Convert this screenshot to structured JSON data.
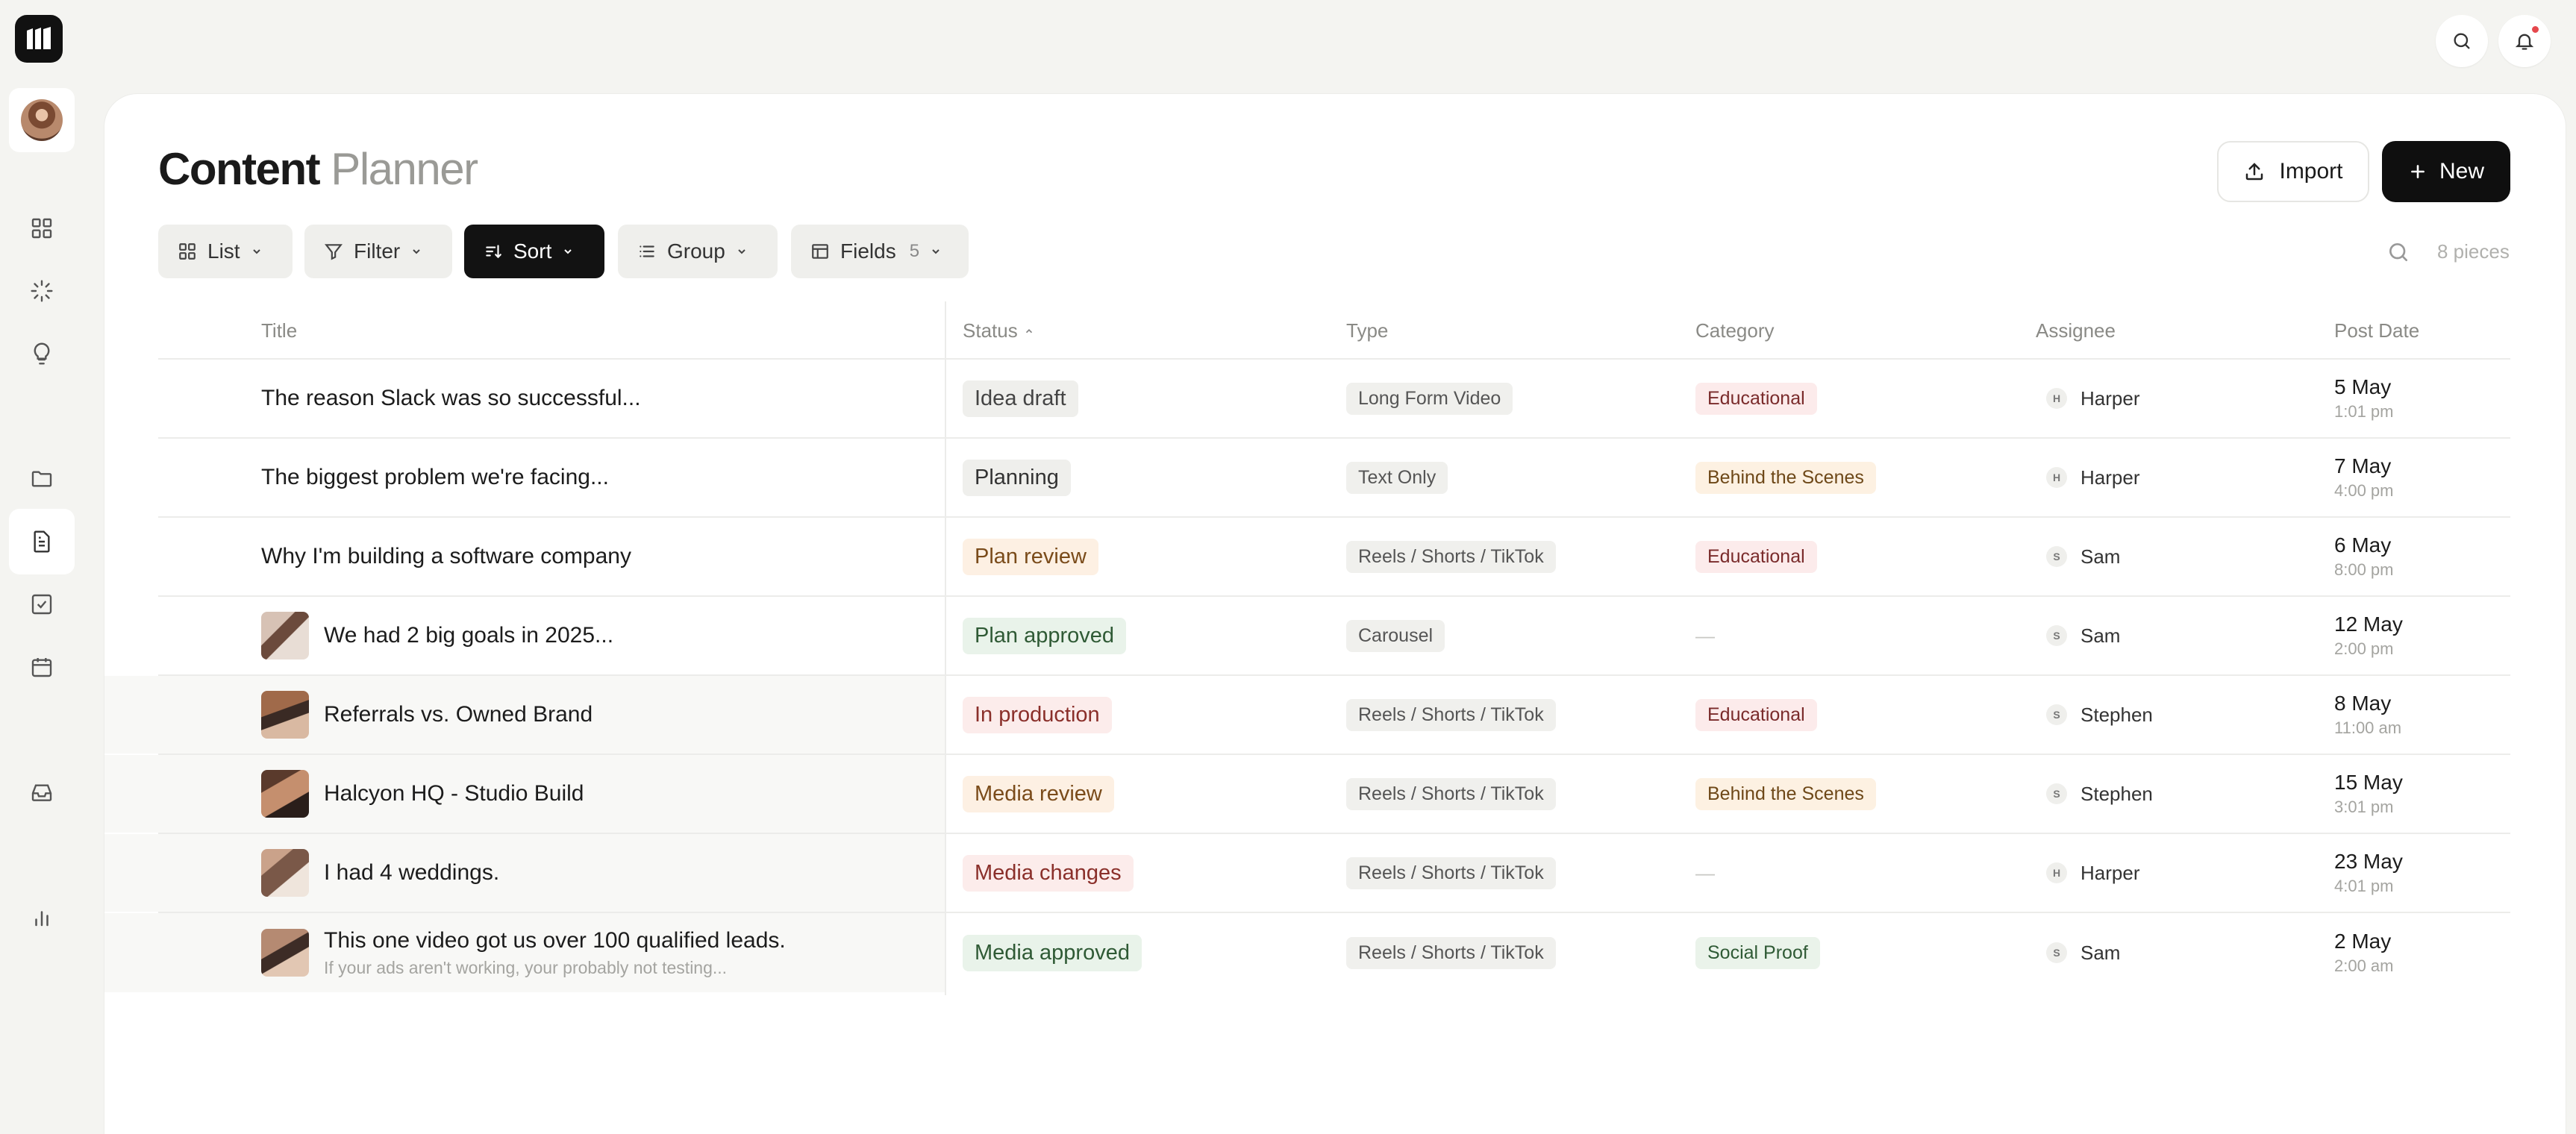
{
  "header": {
    "title_bold": "Content",
    "title_light": "Planner",
    "import_label": "Import",
    "new_label": "New"
  },
  "toolbar": {
    "list_label": "List",
    "filter_label": "Filter",
    "sort_label": "Sort",
    "group_label": "Group",
    "fields_label": "Fields",
    "fields_count": "5",
    "pieces_label": "8 pieces"
  },
  "columns": {
    "title": "Title",
    "status": "Status",
    "type": "Type",
    "category": "Category",
    "assignee": "Assignee",
    "post_date": "Post Date"
  },
  "rows": [
    {
      "title": "The reason Slack was so successful...",
      "subtitle": "",
      "status": "Idea draft",
      "type": "Long Form Video",
      "category": "Educational",
      "assignee": "Harper",
      "initial": "H",
      "date": "5 May",
      "time": "1:01 pm"
    },
    {
      "title": "The biggest problem we're facing...",
      "subtitle": "",
      "status": "Planning",
      "type": "Text Only",
      "category": "Behind the Scenes",
      "assignee": "Harper",
      "initial": "H",
      "date": "7 May",
      "time": "4:00 pm"
    },
    {
      "title": "Why I'm building a software company",
      "subtitle": "",
      "status": "Plan review",
      "type": "Reels / Shorts / TikTok",
      "category": "Educational",
      "assignee": "Sam",
      "initial": "S",
      "date": "6 May",
      "time": "8:00 pm"
    },
    {
      "title": "We had 2 big goals in 2025...",
      "subtitle": "",
      "status": "Plan approved",
      "type": "Carousel",
      "category": "—",
      "assignee": "Sam",
      "initial": "S",
      "date": "12 May",
      "time": "2:00 pm"
    },
    {
      "title": "Referrals vs. Owned Brand",
      "subtitle": "",
      "status": "In production",
      "type": "Reels / Shorts / TikTok",
      "category": "Educational",
      "assignee": "Stephen",
      "initial": "S",
      "date": "8 May",
      "time": "11:00 am"
    },
    {
      "title": "Halcyon HQ - Studio Build",
      "subtitle": "",
      "status": "Media review",
      "type": "Reels / Shorts / TikTok",
      "category": "Behind the Scenes",
      "assignee": "Stephen",
      "initial": "S",
      "date": "15 May",
      "time": "3:01 pm"
    },
    {
      "title": "I had 4 weddings.",
      "subtitle": "",
      "status": "Media changes",
      "type": "Reels / Shorts / TikTok",
      "category": "—",
      "assignee": "Harper",
      "initial": "H",
      "date": "23 May",
      "time": "4:01 pm"
    },
    {
      "title": "This one video got us over 100 qualified leads.",
      "subtitle": "If your ads aren't working, your probably not testing...",
      "status": "Media approved",
      "type": "Reels / Shorts / TikTok",
      "category": "Social Proof",
      "assignee": "Sam",
      "initial": "S",
      "date": "2 May",
      "time": "2:00 am"
    }
  ],
  "colors": {
    "accent": "#111111",
    "notification": "#e5484d",
    "status_gray": "#f0efec",
    "status_orange": "#fdf0e3",
    "status_red": "#fceceb",
    "status_green": "#e9f3ea",
    "category_red": "#fcebeb",
    "category_orange": "#fdf1e2",
    "category_green": "#eaf3ea"
  }
}
